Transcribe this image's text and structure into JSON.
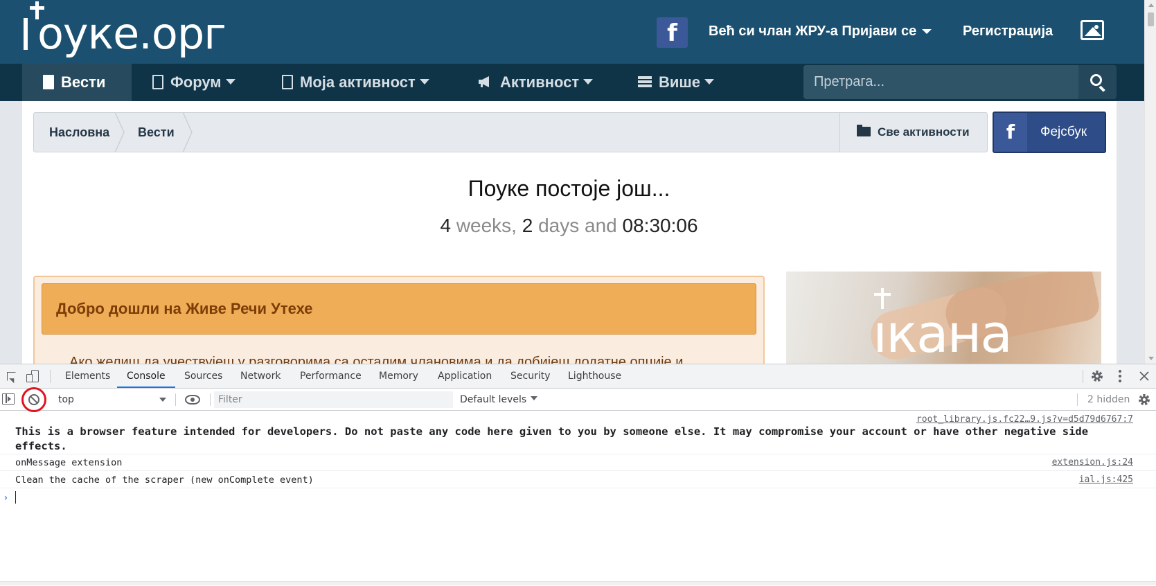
{
  "site": {
    "logo_text": "оуке.орг",
    "login_label": "Већ си члан ЖРУ-а Пријави се",
    "register_label": "Регистрација",
    "facebook_letter": "f"
  },
  "nav": {
    "items": [
      {
        "label": "Вести",
        "icon": "document-icon",
        "active": true
      },
      {
        "label": "Форум",
        "icon": "document-outline-icon",
        "has_caret": true
      },
      {
        "label": "Моја активност",
        "icon": "document-outline-icon",
        "has_caret": true
      },
      {
        "label": "Активност",
        "icon": "megaphone-icon",
        "has_caret": true
      },
      {
        "label": "Више",
        "icon": "bars-icon",
        "has_caret": true
      }
    ],
    "search_placeholder": "Претрага..."
  },
  "breadcrumb": {
    "items": [
      "Насловна",
      "Вести"
    ],
    "all_activity_label": "Све активности",
    "facebook_label": "Фејсбук"
  },
  "countdown": {
    "title": "Поуке постоје још...",
    "weeks_value": "4",
    "weeks_unit": "weeks,",
    "days_value": "2",
    "days_unit": "days and",
    "time": "08:30:06"
  },
  "welcome": {
    "header": "Добро дошли на Живе Речи Утехе",
    "text": "Ако желиш да учествујеш у разговорима са осталим члановима и да добијеш додатне опције и"
  },
  "ad": {
    "text": "ıкана"
  },
  "devtools": {
    "tabs": [
      "Elements",
      "Console",
      "Sources",
      "Network",
      "Performance",
      "Memory",
      "Application",
      "Security",
      "Lighthouse"
    ],
    "active_tab": "Console",
    "context": "top",
    "filter_placeholder": "Filter",
    "levels": "Default levels",
    "hidden_count": "2 hidden",
    "messages": [
      {
        "source": "root_library.js.fc22…9.js?v=d5d79d6767:7",
        "text": "This is a browser feature intended for developers. Do not paste any code here given to you by someone else. It may compromise your account or have other negative side effects."
      },
      {
        "source": "extension.js:24",
        "text": "onMessage extension"
      },
      {
        "source": "ial.js:425",
        "text": "Clean the cache of the scraper (new onComplete event)"
      }
    ],
    "prompt_symbol": "›"
  },
  "colors": {
    "header_bg": "#1b5070",
    "nav_bg": "#0f3347",
    "facebook": "#3b5998",
    "welcome_header": "#f0ad58",
    "highlight_ring": "#e0141e",
    "devtools_accent": "#1a73e8"
  }
}
